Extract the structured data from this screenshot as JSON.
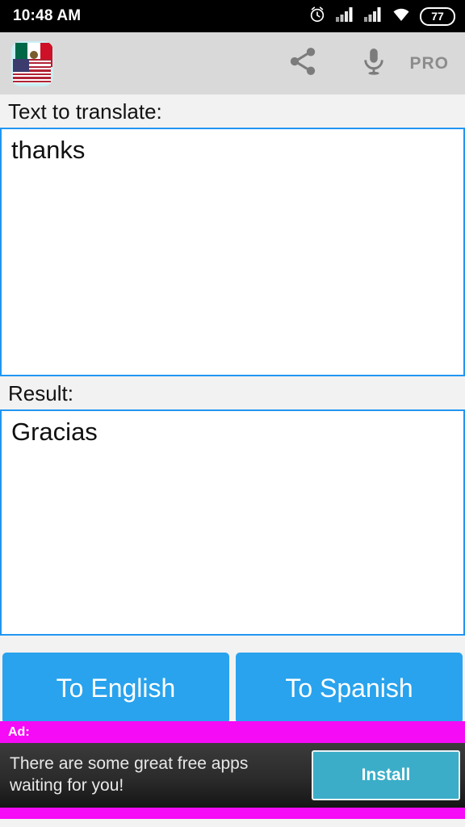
{
  "status_bar": {
    "time": "10:48 AM",
    "battery_level": "77",
    "icons": [
      "alarm-clock-icon",
      "signal-bars-icon",
      "signal-bars-icon",
      "wifi-icon",
      "battery-icon"
    ]
  },
  "toolbar": {
    "app_icon_name": "app-icon-mexico-usa-flags",
    "share_icon": "share-icon",
    "mic_icon": "microphone-icon",
    "pro_label": "PRO"
  },
  "main": {
    "input_label": "Text to translate:",
    "input_value": "thanks",
    "input_placeholder": "",
    "result_label": "Result:",
    "result_value": "Gracias",
    "buttons": {
      "to_english": "To English",
      "to_spanish": "To Spanish"
    }
  },
  "ad": {
    "label": "Ad:",
    "text": "There are some great free apps waiting for you!",
    "install_label": "Install"
  },
  "colors": {
    "accent_blue": "#29a3ed",
    "field_border": "#2196f3",
    "ad_magenta": "#f50bf5",
    "install_teal": "#3badc8",
    "toolbar_gray": "#d9d9d9",
    "page_bg": "#f2f2f2"
  }
}
